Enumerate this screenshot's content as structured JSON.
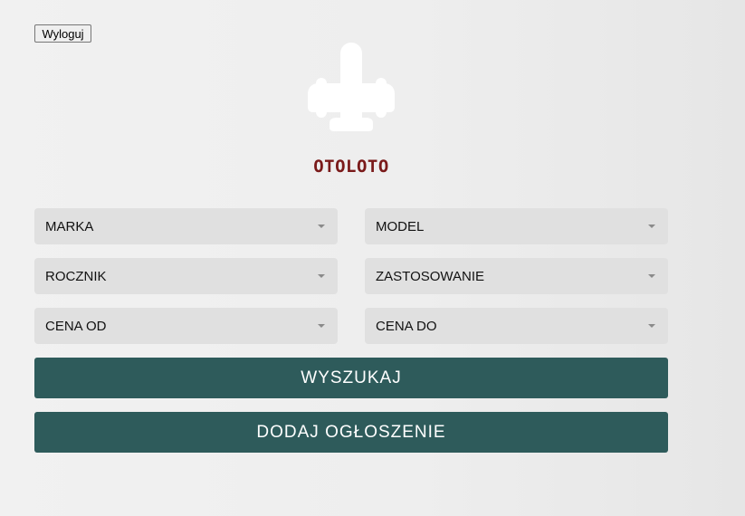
{
  "header": {
    "logout_label": "Wyloguj",
    "logo_icon": "airplane-icon",
    "brand": "OTOLOTO"
  },
  "filters": {
    "marka": "MARKA",
    "model": "MODEL",
    "rocznik": "ROCZNIK",
    "zastosowanie": "ZASTOSOWANIE",
    "cena_od": "CENA OD",
    "cena_do": "CENA DO"
  },
  "actions": {
    "search_label": "WYSZUKAJ",
    "add_label": "DODAJ OGŁOSZENIE"
  },
  "colors": {
    "accent": "#2e5b5b",
    "brand_text": "#7a1a1a",
    "select_bg": "#e0e0e0"
  }
}
